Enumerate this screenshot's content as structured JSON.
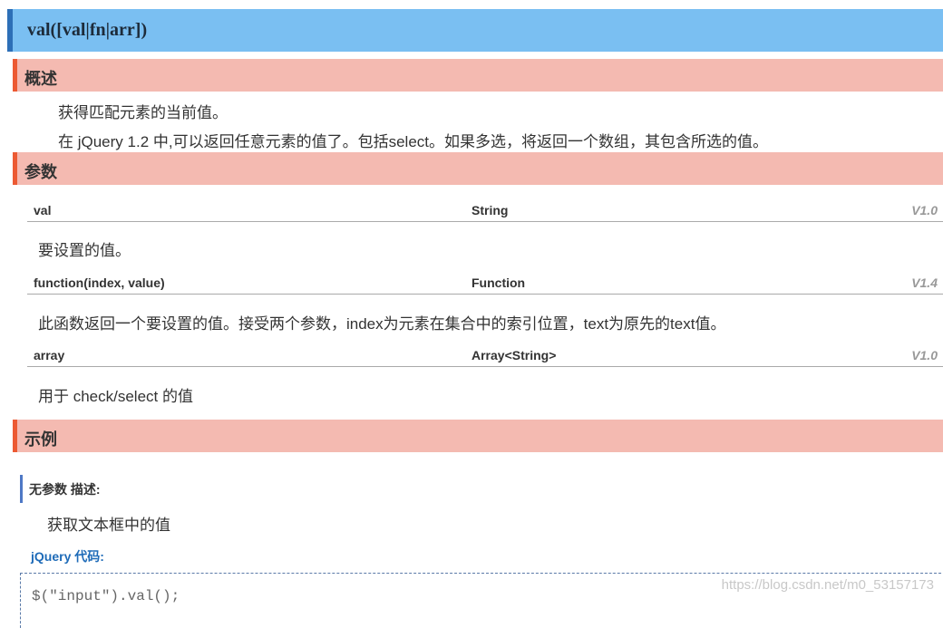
{
  "title": "val([val|fn|arr])",
  "sections": {
    "overview": "概述",
    "params": "参数",
    "examples": "示例"
  },
  "overview_lines": [
    "获得匹配元素的当前值。",
    "在 jQuery 1.2 中,可以返回任意元素的值了。包括select。如果多选，将返回一个数组，其包含所选的值。"
  ],
  "params": [
    {
      "name": "val",
      "type": "String",
      "version": "V1.0",
      "desc": "要设置的值。"
    },
    {
      "name": "function(index, value)",
      "type": "Function",
      "version": "V1.4",
      "desc": "此函数返回一个要设置的值。接受两个参数，index为元素在集合中的索引位置，text为原先的text值。"
    },
    {
      "name": "array",
      "type": "Array<String>",
      "version": "V1.0",
      "desc": "用于 check/select 的值"
    }
  ],
  "example": {
    "heading": "无参数 描述:",
    "description": "获取文本框中的值",
    "code_label": "jQuery 代码:",
    "code": "$(\"input\").val();"
  },
  "watermark": "https://blog.csdn.net/m0_53157173"
}
